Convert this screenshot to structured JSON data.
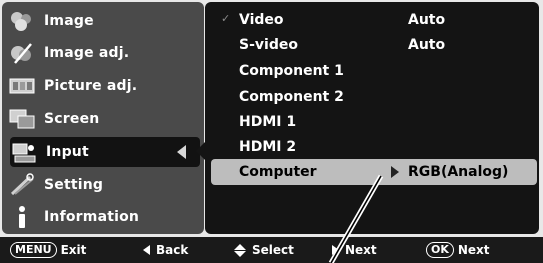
{
  "menu": {
    "items": [
      {
        "label": "Image",
        "icon": "image-icon"
      },
      {
        "label": "Image adj.",
        "icon": "image-adj-icon"
      },
      {
        "label": "Picture adj.",
        "icon": "picture-adj-icon"
      },
      {
        "label": "Screen",
        "icon": "screen-icon"
      },
      {
        "label": "Input",
        "icon": "input-icon",
        "active": true
      },
      {
        "label": "Setting",
        "icon": "setting-icon"
      },
      {
        "label": "Information",
        "icon": "information-icon"
      }
    ]
  },
  "submenu": {
    "items": [
      {
        "name": "Video",
        "value": "Auto",
        "checked": true
      },
      {
        "name": "S-video",
        "value": "Auto"
      },
      {
        "name": "Component 1",
        "value": ""
      },
      {
        "name": "Component 2",
        "value": ""
      },
      {
        "name": "HDMI 1",
        "value": ""
      },
      {
        "name": "HDMI 2",
        "value": ""
      },
      {
        "name": "Computer",
        "value": "RGB(Analog)",
        "selected": true
      }
    ]
  },
  "footer": {
    "menu_key": "MENU",
    "exit": "Exit",
    "back": "Back",
    "select": "Select",
    "next": "Next",
    "ok_key": "OK",
    "ok_next": "Next"
  },
  "colors": {
    "left_panel": "#4a4a4a",
    "right_panel": "#141414",
    "selected_row": "#bdbdbd",
    "active_menu": "#121212"
  }
}
